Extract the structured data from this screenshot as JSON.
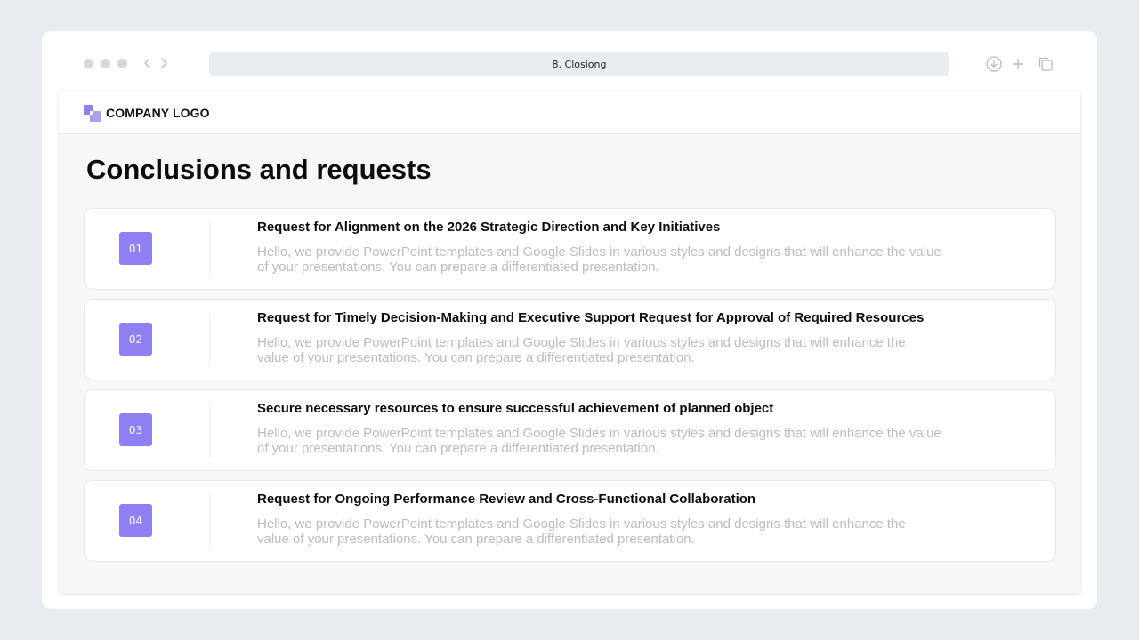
{
  "browser": {
    "tab_title": "8. Closiong",
    "icons": {
      "back": "chevron-left-icon",
      "forward": "chevron-right-icon",
      "download": "download-icon",
      "new_tab": "plus-icon",
      "duplicate": "copy-icon"
    }
  },
  "slide": {
    "logo_text": "COMPANY LOGO",
    "title": "Conclusions and requests",
    "accent_color": "#8e7ff2",
    "items": [
      {
        "number": "01",
        "title": "Request for Alignment on the 2026 Strategic Direction and Key Initiatives",
        "desc_line1": "Hello, we provide PowerPoint templates and Google Slides in various styles and designs that will enhance the value",
        "desc_line2": "of your presentations. You can prepare a differentiated  presentation."
      },
      {
        "number": "02",
        "title": "Request for Timely Decision-Making and Executive Support Request for Approval of Required Resources",
        "desc_line1": "Hello, we provide PowerPoint templates and Google Slides in various styles and designs that will enhance the",
        "desc_line2": "value of your presentations. You can prepare a differentiated presentation."
      },
      {
        "number": "03",
        "title": "Secure necessary resources to ensure successful achievement of planned object",
        "desc_line1": "Hello, we provide PowerPoint templates and Google Slides in various styles and designs that will enhance the value",
        "desc_line2": "of your presentations. You can prepare a differentiated  presentation."
      },
      {
        "number": "04",
        "title": "Request for Ongoing Performance Review and Cross-Functional Collaboration",
        "desc_line1": "Hello, we provide PowerPoint templates and Google Slides in various styles and designs that will enhance the",
        "desc_line2": "value of your presentations. You can prepare a differentiated presentation."
      }
    ]
  }
}
